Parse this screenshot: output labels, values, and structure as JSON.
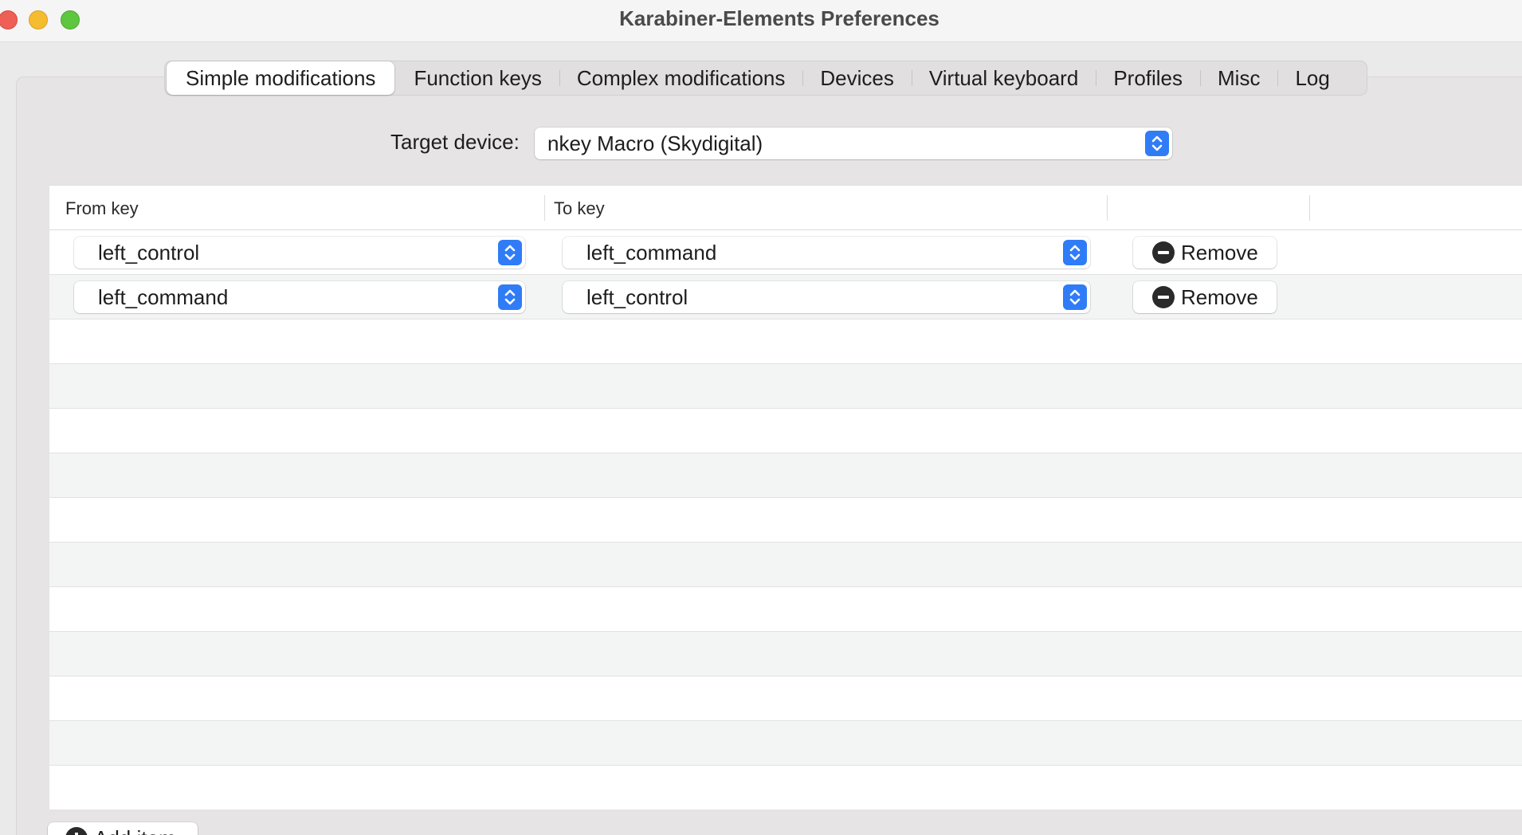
{
  "window": {
    "title": "Karabiner-Elements Preferences"
  },
  "tabs": [
    {
      "label": "Simple modifications",
      "active": true
    },
    {
      "label": "Function keys",
      "active": false
    },
    {
      "label": "Complex modifications",
      "active": false
    },
    {
      "label": "Devices",
      "active": false
    },
    {
      "label": "Virtual keyboard",
      "active": false
    },
    {
      "label": "Profiles",
      "active": false
    },
    {
      "label": "Misc",
      "active": false
    },
    {
      "label": "Log",
      "active": false
    }
  ],
  "target_device": {
    "label": "Target device:",
    "value": "nkey Macro (Skydigital)"
  },
  "table": {
    "columns": [
      "From key",
      "To key"
    ],
    "rows": [
      {
        "from": "left_control",
        "to": "left_command",
        "remove_label": "Remove"
      },
      {
        "from": "left_command",
        "to": "left_control",
        "remove_label": "Remove"
      }
    ]
  },
  "footer": {
    "add_item_label": "Add item"
  },
  "colors": {
    "accent": "#2f7cf6",
    "close": "#ee5f56",
    "minimize": "#f6bc2f",
    "zoom": "#5fc63f"
  },
  "icons": {
    "stepper": "chevron-up-down-icon",
    "remove": "minus-circle-icon",
    "add": "plus-circle-icon"
  }
}
